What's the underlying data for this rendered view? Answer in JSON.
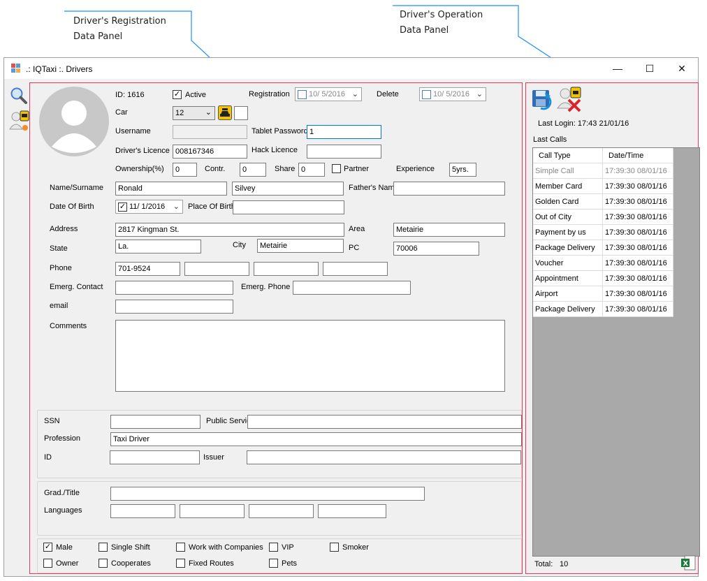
{
  "callouts": {
    "registration": [
      "Driver's Registration",
      "Data Panel"
    ],
    "operation": [
      "Driver's Operation",
      "Data Panel"
    ]
  },
  "window": {
    "title": ".: IQTaxi :. Drivers",
    "minimize": "—",
    "maximize": "☐",
    "close": "✕"
  },
  "reg": {
    "id_label": "ID: 1616",
    "active_label": "Active",
    "active_checked": "✓",
    "registration_label": "Registration",
    "registration_date": "10/  5/2016",
    "delete_label": "Delete",
    "delete_date": "10/  5/2016",
    "car_label": "Car",
    "car_value": "12",
    "username_label": "Username",
    "tablet_password_label": "Tablet Password",
    "tablet_password_value": "1",
    "drivers_licence_label": "Driver's Licence",
    "drivers_licence_value": "008167346",
    "hack_licence_label": "Hack Licence",
    "ownership_label": "Ownership(%)",
    "ownership_value": "0",
    "contr_label": "Contr.",
    "contr_value": "0",
    "share_label": "Share",
    "share_value": "0",
    "partner_label": "Partner",
    "experience_label": "Experience",
    "experience_value": "5yrs.",
    "name_label": "Name/Surname",
    "name_value": "Ronald",
    "surname_value": "Silvey",
    "father_label": "Father's Nam",
    "dob_label": "Date Of Birth",
    "dob_value": "11/  1/2016",
    "pob_label": "Place Of Birth",
    "address_label": "Address",
    "address_value": "2817 Kingman St.",
    "area_label": "Area",
    "area_value": "Metairie",
    "state_label": "State",
    "state_value": "La.",
    "city_label": "City",
    "city_value": "Metairie",
    "pc_label": "PC",
    "pc_value": "70006",
    "phone_label": "Phone",
    "phone_value": "701-9524",
    "emerg_contact_label": "Emerg. Contact",
    "emerg_phone_label": "Emerg. Phone",
    "email_label": "email",
    "comments_label": "Comments",
    "ssn_label": "SSN",
    "public_service_label": "Public Servic",
    "profession_label": "Profession",
    "profession_value": "Taxi Driver",
    "id2_label": "ID",
    "issuer_label": "Issuer",
    "grad_label": "Grad./Title",
    "languages_label": "Languages",
    "flags": {
      "male": "Male",
      "male_checked": "✓",
      "single_shift": "Single Shift",
      "work_with_companies": "Work with Companies",
      "vip": "VIP",
      "smoker": "Smoker",
      "owner": "Owner",
      "cooperates": "Cooperates",
      "fixed_routes": "Fixed Routes",
      "pets": "Pets"
    }
  },
  "ops": {
    "last_login": "Last Login: 17:43 21/01/16",
    "last_calls_label": "Last Calls",
    "col_type": "Call Type",
    "col_date": "Date/Time",
    "calls": [
      {
        "type": "Simple Call",
        "date": "17:39:30 08/01/16"
      },
      {
        "type": "Member Card",
        "date": "17:39:30 08/01/16"
      },
      {
        "type": "Golden Card",
        "date": "17:39:30 08/01/16"
      },
      {
        "type": "Out of City",
        "date": "17:39:30 08/01/16"
      },
      {
        "type": "Payment by us",
        "date": "17:39:30 08/01/16"
      },
      {
        "type": "Package Delivery",
        "date": "17:39:30 08/01/16"
      },
      {
        "type": "Voucher",
        "date": "17:39:30 08/01/16"
      },
      {
        "type": "Appointment",
        "date": "17:39:30 08/01/16"
      },
      {
        "type": "Airport",
        "date": "17:39:30 08/01/16"
      },
      {
        "type": "Package Delivery",
        "date": "17:39:30 08/01/16"
      }
    ],
    "total_label": "Total:",
    "total_value": "10"
  }
}
